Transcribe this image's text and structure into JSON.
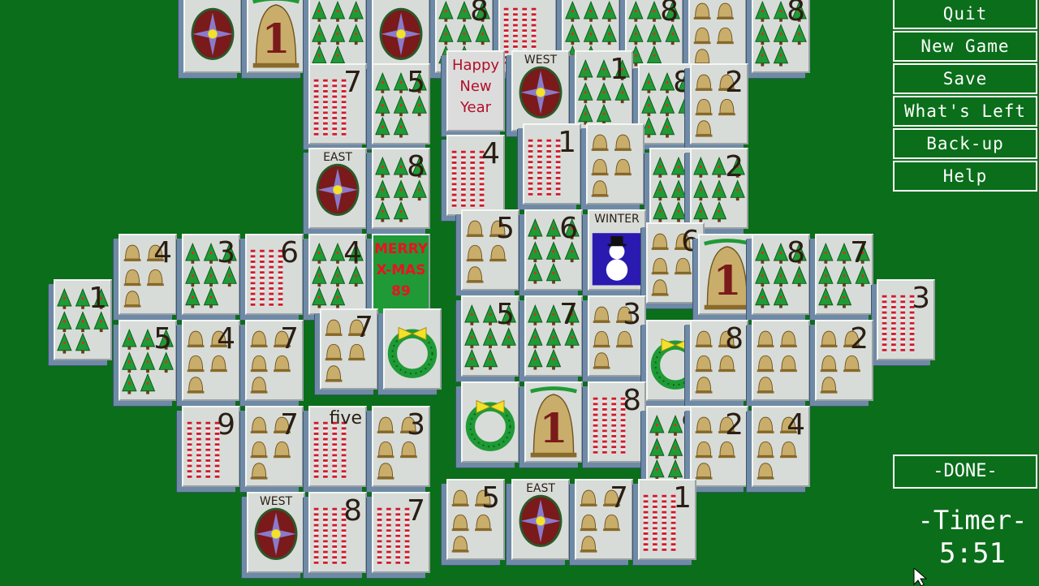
{
  "menu": {
    "quit": "Quit",
    "new_game": "New Game",
    "save": "Save",
    "whats_left": "What's Left",
    "backup": "Back-up",
    "help": "Help"
  },
  "done_label": "-DONE-",
  "timer": {
    "label": "-Timer-",
    "value": "5:51"
  },
  "colors": {
    "felt": "#0a6e1a",
    "tile_face": "#d8dcd8",
    "tile_side": "#6f8aa6",
    "menu_text": "#ffffff"
  },
  "tiles": [
    {
      "suit": "season",
      "text": ""
    },
    {
      "suit": "bell-big",
      "text": "1"
    },
    {
      "suit": "tree",
      "text": ""
    },
    {
      "suit": "season",
      "text": ""
    },
    {
      "suit": "tree",
      "text": "8"
    },
    {
      "suit": "cane",
      "text": ""
    },
    {
      "suit": "tree",
      "text": ""
    },
    {
      "suit": "tree",
      "text": "8"
    },
    {
      "suit": "bell",
      "text": ""
    },
    {
      "suit": "tree",
      "text": "8"
    },
    {
      "suit": "cane",
      "text": "7"
    },
    {
      "suit": "tree",
      "text": "5"
    },
    {
      "suit": "newyear",
      "text": "Happy|New|Year"
    },
    {
      "suit": "wind",
      "text": "WEST"
    },
    {
      "suit": "tree",
      "text": "1"
    },
    {
      "suit": "tree",
      "text": "8"
    },
    {
      "suit": "bell",
      "text": "2"
    },
    {
      "suit": "wind",
      "text": "EAST"
    },
    {
      "suit": "tree",
      "text": "8"
    },
    {
      "suit": "cane",
      "text": "4"
    },
    {
      "suit": "cane",
      "text": "1"
    },
    {
      "suit": "bell",
      "text": ""
    },
    {
      "suit": "tree",
      "text": "4"
    },
    {
      "suit": "tree",
      "text": "2"
    },
    {
      "suit": "bell",
      "text": "4"
    },
    {
      "suit": "tree",
      "text": "3"
    },
    {
      "suit": "cane",
      "text": "6"
    },
    {
      "suit": "tree",
      "text": "4"
    },
    {
      "suit": "xmas",
      "text": "MERRY|X-MAS|89"
    },
    {
      "suit": "bell",
      "text": "5"
    },
    {
      "suit": "tree",
      "text": "6"
    },
    {
      "suit": "winter",
      "text": "WINTER"
    },
    {
      "suit": "bell",
      "text": "6"
    },
    {
      "suit": "bell-big",
      "text": "1"
    },
    {
      "suit": "tree",
      "text": "8"
    },
    {
      "suit": "tree",
      "text": "7"
    },
    {
      "suit": "tree",
      "text": "1"
    },
    {
      "suit": "cane",
      "text": "3"
    },
    {
      "suit": "tree",
      "text": "5"
    },
    {
      "suit": "bell",
      "text": "4"
    },
    {
      "suit": "bell",
      "text": "7"
    },
    {
      "suit": "bell",
      "text": "7"
    },
    {
      "suit": "wreath",
      "text": ""
    },
    {
      "suit": "tree",
      "text": "5"
    },
    {
      "suit": "tree",
      "text": "7"
    },
    {
      "suit": "bell",
      "text": "3"
    },
    {
      "suit": "wreath",
      "text": ""
    },
    {
      "suit": "bell",
      "text": "8"
    },
    {
      "suit": "bell",
      "text": ""
    },
    {
      "suit": "bell",
      "text": "2"
    },
    {
      "suit": "cane",
      "text": "9"
    },
    {
      "suit": "bell",
      "text": "7"
    },
    {
      "suit": "cane",
      "text": "five"
    },
    {
      "suit": "bell",
      "text": "3"
    },
    {
      "suit": "wreath",
      "text": ""
    },
    {
      "suit": "bell-big",
      "text": "1"
    },
    {
      "suit": "cane",
      "text": "8"
    },
    {
      "suit": "tree",
      "text": "9"
    },
    {
      "suit": "bell",
      "text": "2"
    },
    {
      "suit": "bell",
      "text": "4"
    },
    {
      "suit": "wind",
      "text": "WEST"
    },
    {
      "suit": "cane",
      "text": "8"
    },
    {
      "suit": "cane",
      "text": "7"
    },
    {
      "suit": "bell",
      "text": "5"
    },
    {
      "suit": "wind",
      "text": "EAST"
    },
    {
      "suit": "bell",
      "text": "7"
    },
    {
      "suit": "cane",
      "text": "1"
    }
  ]
}
